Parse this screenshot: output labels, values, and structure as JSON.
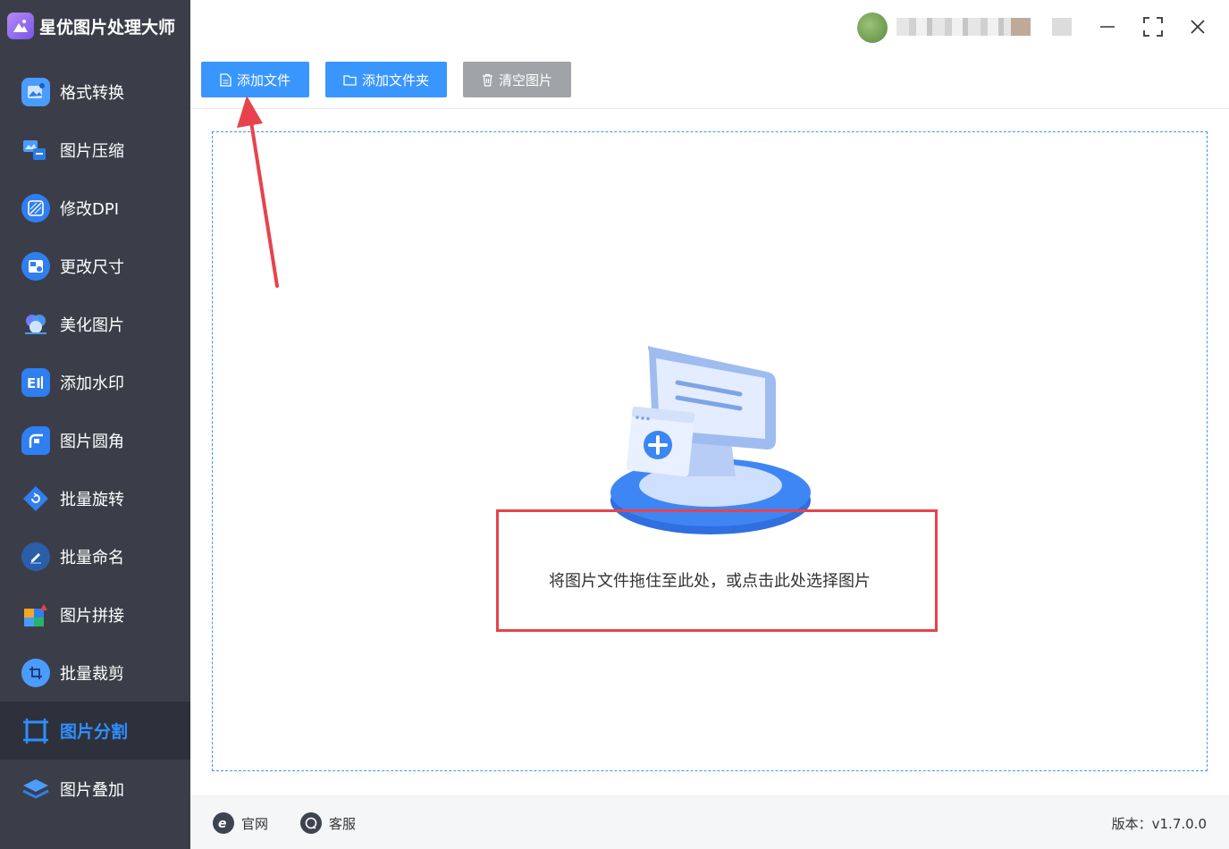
{
  "app": {
    "title": "星优图片处理大师"
  },
  "sidebar": {
    "items": [
      {
        "label": "格式转换",
        "icon": "format-convert-icon"
      },
      {
        "label": "图片压缩",
        "icon": "image-compress-icon"
      },
      {
        "label": "修改DPI",
        "icon": "dpi-icon"
      },
      {
        "label": "更改尺寸",
        "icon": "resize-icon"
      },
      {
        "label": "美化图片",
        "icon": "beautify-icon"
      },
      {
        "label": "添加水印",
        "icon": "watermark-icon"
      },
      {
        "label": "图片圆角",
        "icon": "rounded-corner-icon"
      },
      {
        "label": "批量旋转",
        "icon": "rotate-icon"
      },
      {
        "label": "批量命名",
        "icon": "rename-icon"
      },
      {
        "label": "图片拼接",
        "icon": "stitch-icon"
      },
      {
        "label": "批量裁剪",
        "icon": "crop-icon"
      },
      {
        "label": "图片分割",
        "icon": "split-icon",
        "active": true
      },
      {
        "label": "图片叠加",
        "icon": "layers-icon"
      }
    ]
  },
  "toolbar": {
    "add_file": "添加文件",
    "add_folder": "添加文件夹",
    "clear_images": "清空图片"
  },
  "dropzone": {
    "text": "将图片文件拖住至此处，或点击此处选择图片"
  },
  "footer": {
    "website": "官网",
    "support": "客服",
    "version": "版本：v1.7.0.0"
  },
  "colors": {
    "sidebar_bg": "#3b3e49",
    "accent": "#3a96ff",
    "annotation_red": "#e8424c"
  }
}
